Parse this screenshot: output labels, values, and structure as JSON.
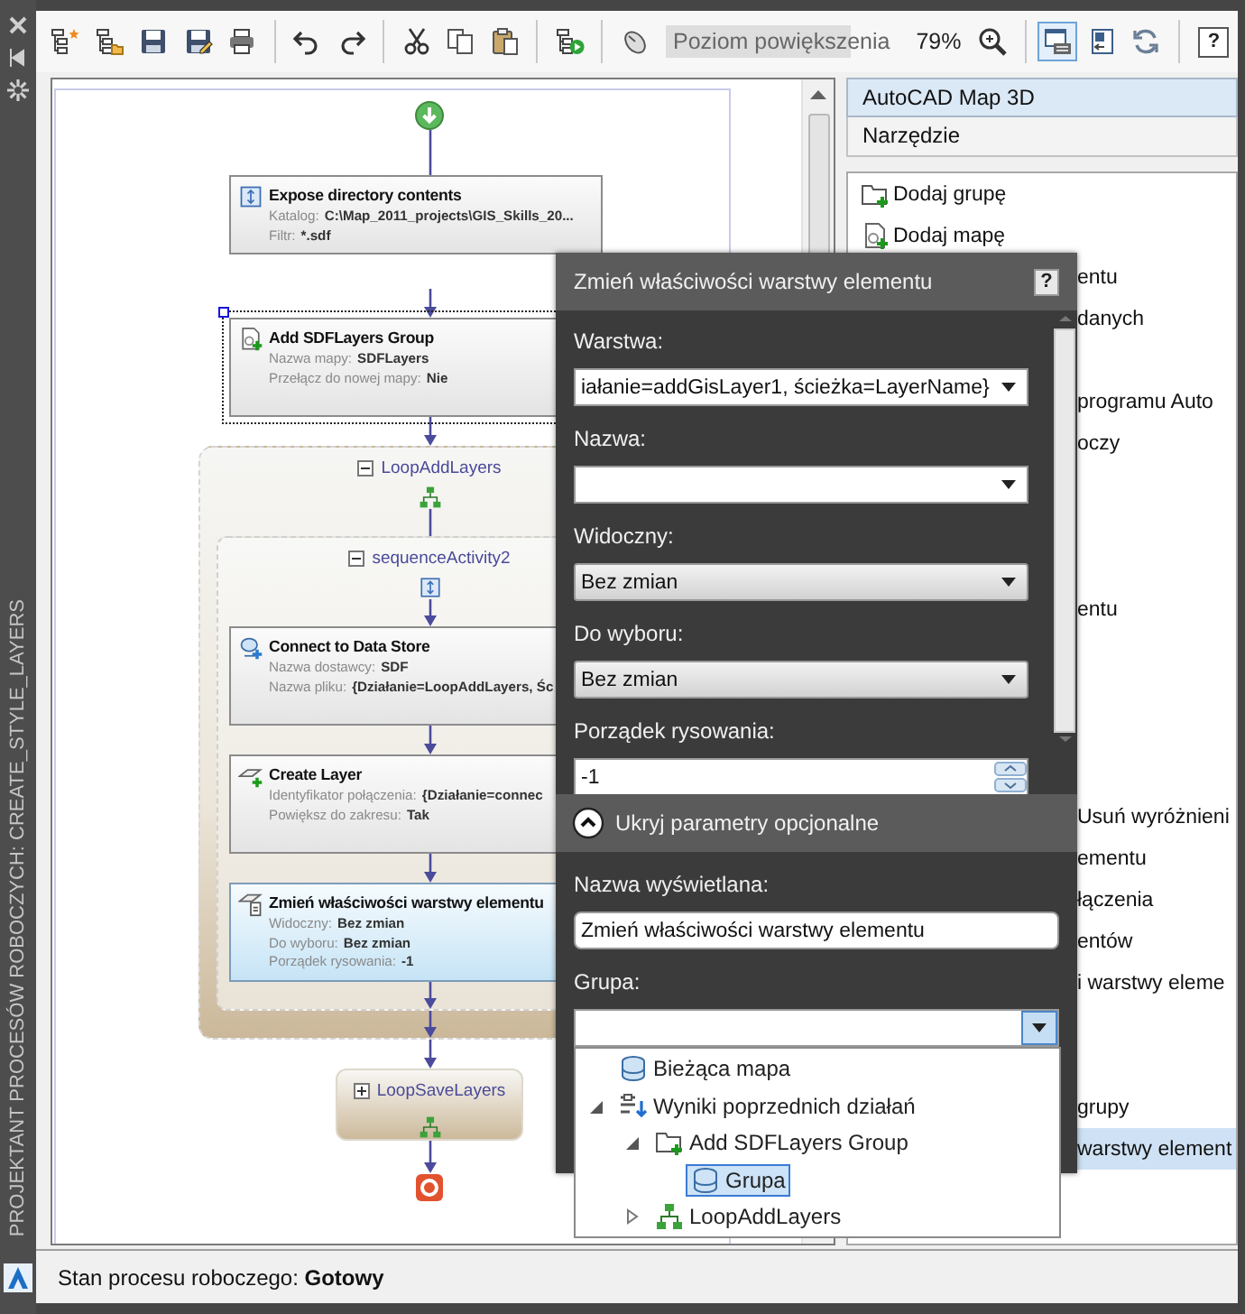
{
  "side_strip": {
    "title": "PROJEKTANT PROCESÓW ROBOCZYCH: CREATE_STYLE_LAYERS"
  },
  "toolbar": {
    "groups": [
      [
        {
          "kind": "new",
          "selected": false
        },
        {
          "kind": "open",
          "selected": false
        },
        {
          "kind": "save",
          "selected": false
        },
        {
          "kind": "save-as",
          "selected": false
        },
        {
          "kind": "print",
          "selected": false
        }
      ],
      [
        {
          "kind": "undo",
          "selected": false
        },
        {
          "kind": "redo",
          "selected": false
        }
      ],
      [
        {
          "kind": "cut",
          "selected": false
        },
        {
          "kind": "copy",
          "selected": false
        },
        {
          "kind": "paste",
          "selected": false
        }
      ],
      [
        {
          "kind": "run",
          "selected": false
        }
      ],
      [
        {
          "kind": "mouse",
          "selected": false
        },
        {
          "kind": "label",
          "text": "Poziom powiększenia"
        },
        {
          "kind": "value",
          "text": "79%"
        },
        {
          "kind": "zoom",
          "selected": false
        }
      ],
      [
        {
          "kind": "canvas-view",
          "selected": true
        },
        {
          "kind": "properties",
          "selected": false
        },
        {
          "kind": "refresh",
          "selected": false
        }
      ],
      [
        {
          "kind": "help",
          "text": "?",
          "selected": false
        }
      ]
    ]
  },
  "workflow": {
    "steps": [
      {
        "kind": "activity",
        "title": "Expose directory contents",
        "selected": false,
        "focused": false,
        "properties": [
          {
            "name": "Katalog:",
            "value": "C:\\Map_2011_projects\\GIS_Skills_20..."
          },
          {
            "name": "Filtr:",
            "value": "*.sdf"
          }
        ]
      },
      {
        "kind": "activity",
        "title": "Add SDFLayers Group",
        "selected": false,
        "focused": true,
        "properties": [
          {
            "name": "Nazwa mapy:",
            "value": "SDFLayers"
          },
          {
            "name": "Przełącz do nowej mapy:",
            "value": "Nie"
          }
        ]
      },
      {
        "kind": "loop",
        "title": "LoopAddLayers",
        "expanded": true,
        "children": [
          {
            "kind": "sequence",
            "title": "sequenceActivity2",
            "expanded": true,
            "children": [
              {
                "kind": "activity",
                "title": "Connect to Data Store",
                "selected": false,
                "focused": false,
                "properties": [
                  {
                    "name": "Nazwa dostawcy:",
                    "value": "SDF"
                  },
                  {
                    "name": "Nazwa pliku:",
                    "value": "{Działanie=LoopAddLayers, Śc"
                  }
                ]
              },
              {
                "kind": "activity",
                "title": "Create Layer",
                "selected": false,
                "focused": false,
                "properties": [
                  {
                    "name": "Identyfikator połączenia:",
                    "value": "{Działanie=connec"
                  },
                  {
                    "name": "Powiększ do zakresu:",
                    "value": "Tak"
                  }
                ]
              },
              {
                "kind": "activity",
                "title": "Zmień właściwości warstwy elementu",
                "selected": true,
                "focused": false,
                "properties": [
                  {
                    "name": "Widoczny:",
                    "value": "Bez zmian"
                  },
                  {
                    "name": "Do wyboru:",
                    "value": "Bez zmian"
                  },
                  {
                    "name": "Porządek rysowania:",
                    "value": "-1"
                  }
                ]
              }
            ]
          }
        ]
      },
      {
        "kind": "loop",
        "title": "LoopSaveLayers",
        "expanded": false
      }
    ]
  },
  "tools_panel": {
    "title": "AutoCAD Map 3D",
    "category": "Narzędzie",
    "items": [
      {
        "label": "Dodaj grupę",
        "selected": false
      },
      {
        "label": "Dodaj mapę",
        "selected": false
      },
      {
        "label": "entu",
        "selected": false
      },
      {
        "label": "danych",
        "selected": false
      },
      {
        "label": "programu Auto",
        "selected": false
      },
      {
        "label": "oczy",
        "selected": false
      },
      {
        "label": "entu",
        "selected": false
      },
      {
        "label": "Usuń wyróżnieni",
        "selected": false
      },
      {
        "label": "ementu",
        "selected": false
      },
      {
        "label": "łączenia",
        "selected": false
      },
      {
        "label": "entów",
        "selected": false
      },
      {
        "label": "i warstwy eleme",
        "selected": false
      },
      {
        "label": "grupy",
        "selected": false
      },
      {
        "label": "warstwy element",
        "selected": true
      }
    ]
  },
  "properties_dialog": {
    "title": "Zmień właściwości warstwy elementu",
    "help": "?",
    "fields": [
      {
        "kind": "combo",
        "label": "Warstwa:",
        "value": "iałanie=addGisLayer1, ścieżka=LayerName}"
      },
      {
        "kind": "combo",
        "label": "Nazwa:"
      },
      {
        "kind": "choice",
        "label": "Widoczny:",
        "value": "Bez zmian"
      },
      {
        "kind": "choice",
        "label": "Do wyboru:",
        "value": "Bez zmian"
      },
      {
        "kind": "spin",
        "label": "Porządek rysowania:",
        "value": "-1"
      }
    ],
    "optional": {
      "label": "Ukryj parametry opcjonalne",
      "expanded": true,
      "fields": [
        {
          "kind": "text",
          "label": "Nazwa wyświetlana:",
          "value": "Zmień właściwości warstwy elementu"
        },
        {
          "kind": "combo",
          "label": "Grupa:",
          "open": true
        }
      ]
    },
    "dropdown": {
      "items": [
        {
          "kind": "map",
          "label": "Bieżąca mapa",
          "selected": false
        },
        {
          "kind": "results",
          "label": "Wyniki poprzednich działań",
          "selected": false,
          "expanded": true,
          "children": [
            {
              "kind": "group-action",
              "label": "Add SDFLayers Group",
              "selected": false,
              "expanded": true,
              "children": [
                {
                  "kind": "group",
                  "label": "Grupa",
                  "selected": true
                }
              ]
            },
            {
              "kind": "loop",
              "label": "LoopAddLayers",
              "selected": false,
              "expanded": false
            }
          ]
        }
      ]
    }
  },
  "status_bar": {
    "text": "Stan procesu roboczego: **Gotowy**"
  }
}
